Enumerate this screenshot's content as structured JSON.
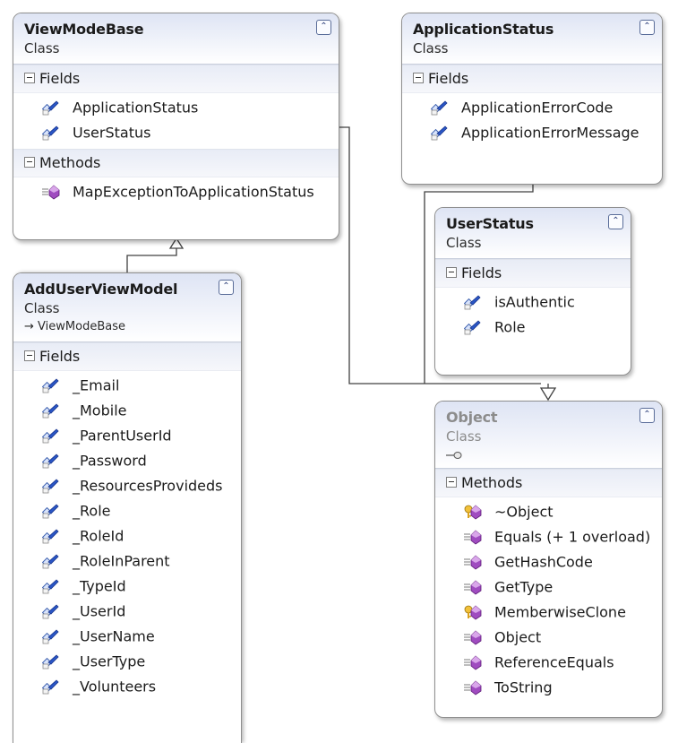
{
  "classes": [
    {
      "name": "ViewModeBase",
      "kind": "Class",
      "sections": [
        {
          "title": "Fields",
          "members": [
            {
              "name": "ApplicationStatus",
              "icon": "field-icon"
            },
            {
              "name": "UserStatus",
              "icon": "field-icon"
            }
          ]
        },
        {
          "title": "Methods",
          "members": [
            {
              "name": "MapExceptionToApplicationStatus",
              "icon": "method-icon"
            }
          ]
        }
      ]
    },
    {
      "name": "ApplicationStatus",
      "kind": "Class",
      "sections": [
        {
          "title": "Fields",
          "members": [
            {
              "name": "ApplicationErrorCode",
              "icon": "field-icon"
            },
            {
              "name": "ApplicationErrorMessage",
              "icon": "field-icon"
            }
          ]
        }
      ]
    },
    {
      "name": "UserStatus",
      "kind": "Class",
      "sections": [
        {
          "title": "Fields",
          "members": [
            {
              "name": "isAuthentic",
              "icon": "field-icon"
            },
            {
              "name": "Role",
              "icon": "field-icon"
            }
          ]
        }
      ]
    },
    {
      "name": "AddUserViewModel",
      "kind": "Class",
      "base": "ViewModeBase",
      "sections": [
        {
          "title": "Fields",
          "members": [
            {
              "name": "_Email",
              "icon": "field-icon"
            },
            {
              "name": "_Mobile",
              "icon": "field-icon"
            },
            {
              "name": "_ParentUserId",
              "icon": "field-icon"
            },
            {
              "name": "_Password",
              "icon": "field-icon"
            },
            {
              "name": "_ResourcesProvideds",
              "icon": "field-icon"
            },
            {
              "name": "_Role",
              "icon": "field-icon"
            },
            {
              "name": "_RoleId",
              "icon": "field-icon"
            },
            {
              "name": "_RoleInParent",
              "icon": "field-icon"
            },
            {
              "name": "_TypeId",
              "icon": "field-icon"
            },
            {
              "name": "_UserId",
              "icon": "field-icon"
            },
            {
              "name": "_UserName",
              "icon": "field-icon"
            },
            {
              "name": "_UserType",
              "icon": "field-icon"
            },
            {
              "name": "_Volunteers",
              "icon": "field-icon"
            }
          ]
        }
      ]
    },
    {
      "name": "Object",
      "kind": "Class",
      "icon": "lollipop-icon",
      "sections": [
        {
          "title": "Methods",
          "members": [
            {
              "name": "~Object",
              "icon": "protected-method-icon"
            },
            {
              "name": "Equals (+ 1 overload)",
              "icon": "method-icon"
            },
            {
              "name": "GetHashCode",
              "icon": "method-icon"
            },
            {
              "name": "GetType",
              "icon": "method-icon"
            },
            {
              "name": "MemberwiseClone",
              "icon": "protected-method-icon"
            },
            {
              "name": "Object",
              "icon": "method-icon"
            },
            {
              "name": "ReferenceEquals",
              "icon": "method-icon"
            },
            {
              "name": "ToString",
              "icon": "method-icon"
            }
          ]
        }
      ]
    }
  ],
  "colors": {
    "header_gradient_top": "#dee4f4",
    "section_band": "#e8ecf6",
    "field_icon": "#2a56c6",
    "method_icon": "#9b39b7",
    "connector": "#404040",
    "muted_title": "#8c8c8c"
  }
}
